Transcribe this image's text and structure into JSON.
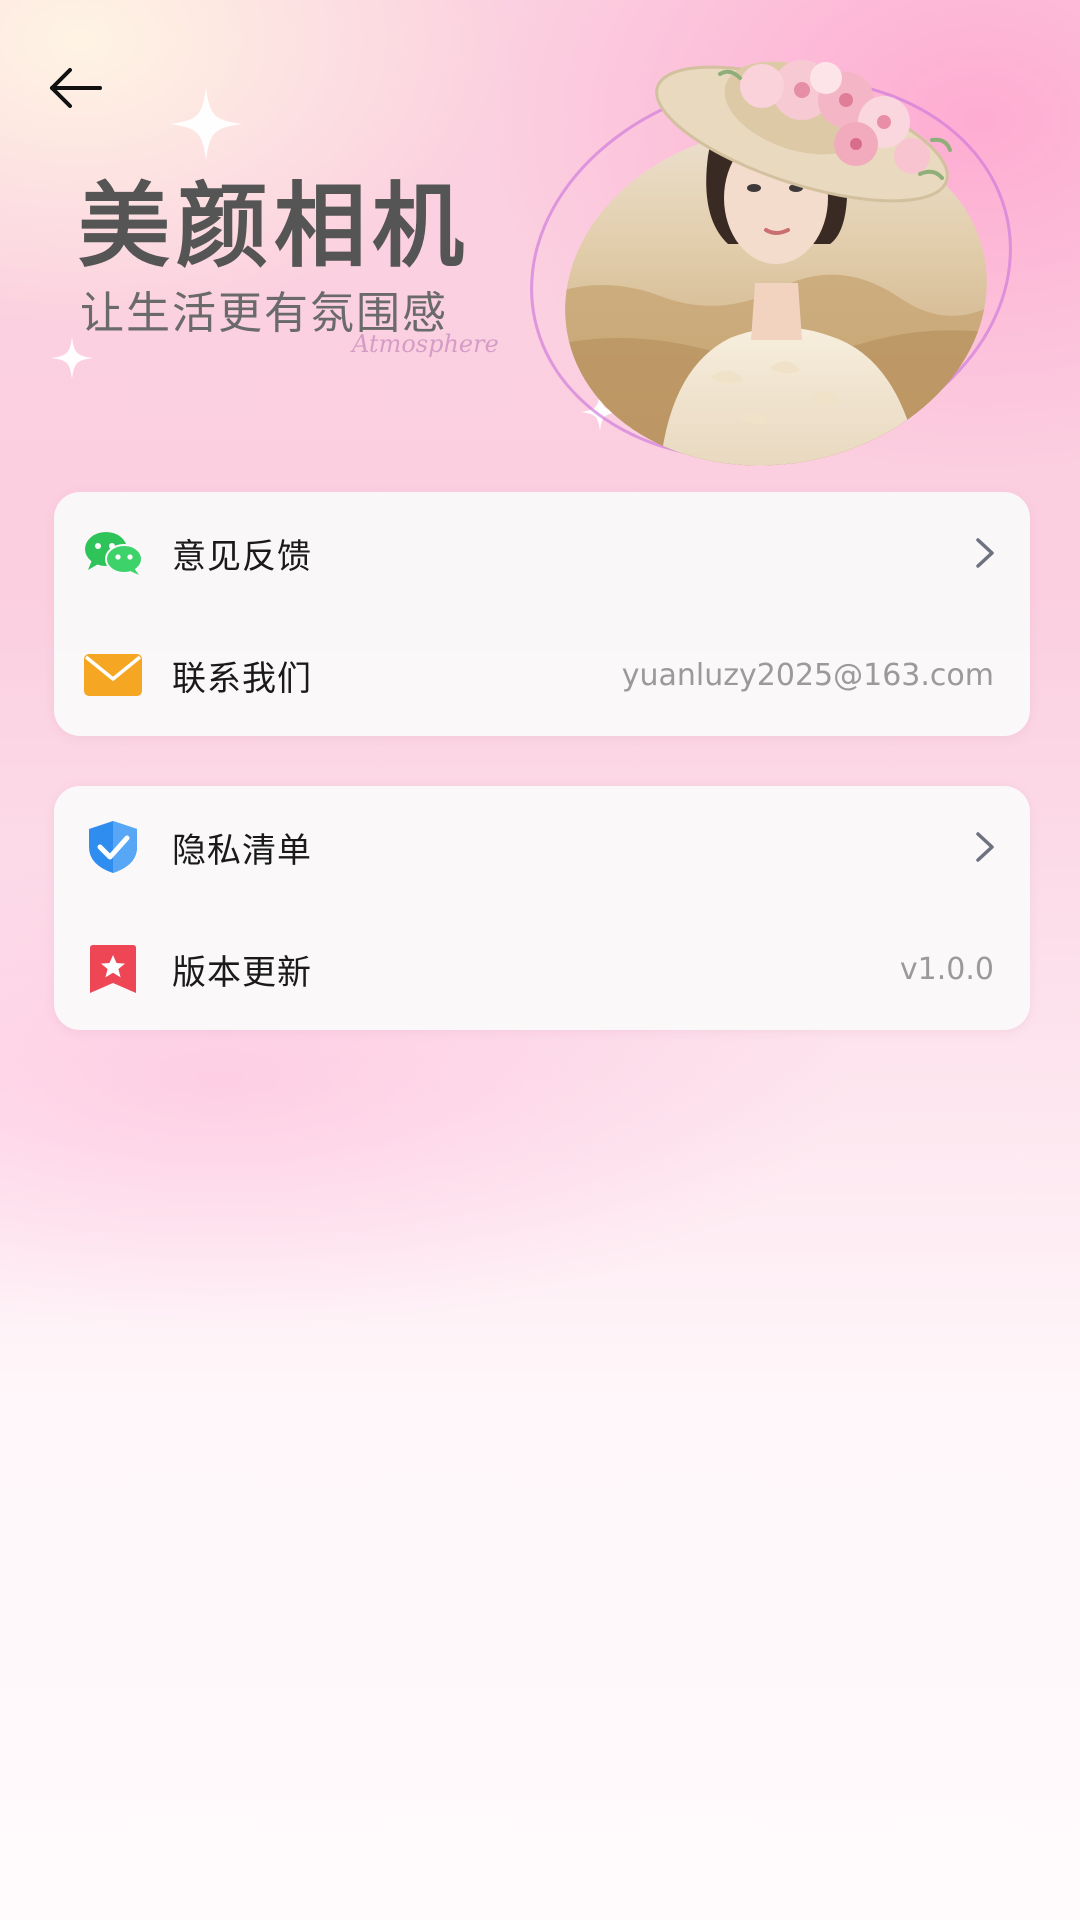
{
  "header": {
    "back_icon": "arrow-left-icon"
  },
  "hero": {
    "title": "美颜相机",
    "subtitle": "让生活更有氛围感",
    "script_text": "Atmosphere"
  },
  "settings_groups": [
    {
      "items": [
        {
          "label": "意见反馈",
          "icon": "wechat-icon",
          "trailing": "chevron-right-icon"
        },
        {
          "label": "联系我们",
          "icon": "mail-icon",
          "value": "yuanluzy2025@163.com"
        }
      ]
    },
    {
      "items": [
        {
          "label": "隐私清单",
          "icon": "shield-check-icon",
          "trailing": "chevron-right-icon"
        },
        {
          "label": "版本更新",
          "icon": "bookmark-star-icon",
          "value": "v1.0.0"
        }
      ]
    }
  ],
  "colors": {
    "wechat_green": "#2fc45a",
    "mail_orange": "#f5a623",
    "shield_blue": "#2f8df0",
    "bookmark_red": "#ef4656",
    "value_gray": "#9a9a9a"
  }
}
